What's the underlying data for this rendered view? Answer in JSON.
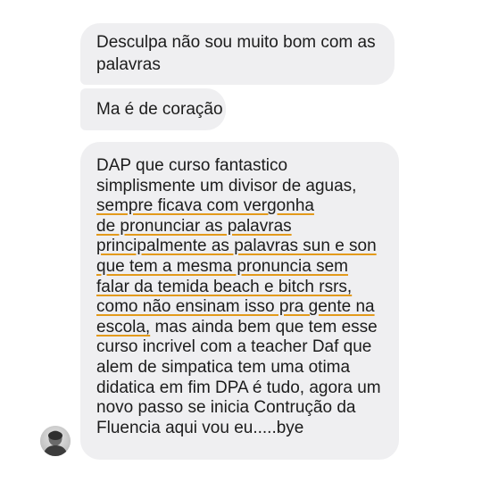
{
  "messages": [
    {
      "lines": [
        "Desculpa não sou muito bom com as",
        "palavras"
      ]
    },
    {
      "text": "Ma é de coração"
    },
    {
      "lines": [
        {
          "text": "DAP que curso fantastico",
          "underlined": false
        },
        {
          "text": "simplismente um divisor de aguas,",
          "underlined": false
        },
        {
          "text": "sempre ficava com vergonha",
          "underlined": true
        },
        {
          "text": "de pronunciar as palavras",
          "underlined": true
        },
        {
          "text": "principalmente as palavras sun e son",
          "underlined": true
        },
        {
          "text": "que tem a mesma pronuncia sem",
          "underlined": true
        },
        {
          "text": "falar da temida beach e bitch rsrs,",
          "underlined": true
        },
        {
          "text": "como não ensinam isso pra gente na",
          "underlined": true
        },
        {
          "text": "escola,",
          "underlined": true,
          "rest": " mas ainda bem que tem esse"
        },
        {
          "text": "curso incrivel com a teacher Daf que",
          "underlined": false
        },
        {
          "text": "alem de simpatica tem uma otima",
          "underlined": false
        },
        {
          "text": "didatica em fim DPA é tudo, agora um",
          "underlined": false
        },
        {
          "text": "novo passo se inicia Contrução da",
          "underlined": false
        },
        {
          "text": "Fluencia aqui vou eu.....bye",
          "underlined": false
        }
      ]
    }
  ],
  "colors": {
    "bubble": "#efeff1",
    "text": "#1c1c1c",
    "underline": "#e39a1b"
  },
  "sender": {
    "avatar_icon": "person-avatar-icon"
  }
}
